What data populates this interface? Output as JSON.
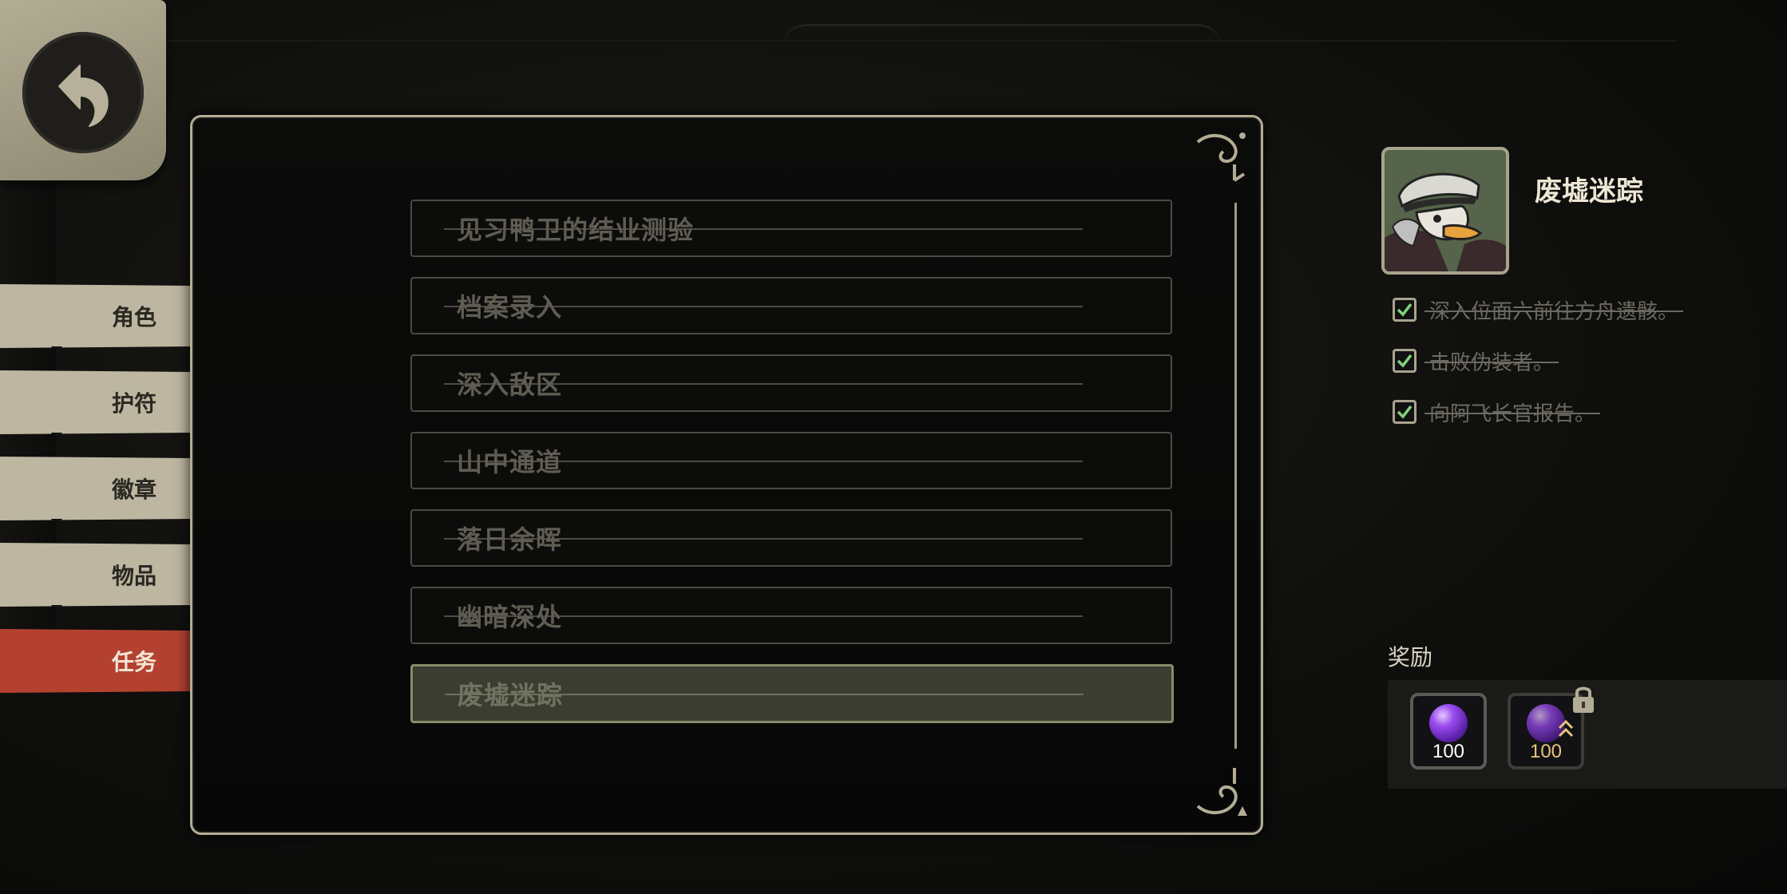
{
  "navigation": {
    "back_icon": "back-arrow-icon"
  },
  "tabs": [
    {
      "label": "角色",
      "active": false
    },
    {
      "label": "护符",
      "active": false
    },
    {
      "label": "徽章",
      "active": false
    },
    {
      "label": "物品",
      "active": false
    },
    {
      "label": "任务",
      "active": true
    }
  ],
  "quests": [
    {
      "label": "见习鸭卫的结业测验",
      "completed": true,
      "selected": false
    },
    {
      "label": "档案录入",
      "completed": true,
      "selected": false
    },
    {
      "label": "深入敌区",
      "completed": true,
      "selected": false
    },
    {
      "label": "山中通道",
      "completed": true,
      "selected": false
    },
    {
      "label": "落日余晖",
      "completed": true,
      "selected": false
    },
    {
      "label": "幽暗深处",
      "completed": true,
      "selected": false
    },
    {
      "label": "废墟迷踪",
      "completed": true,
      "selected": true
    }
  ],
  "detail": {
    "title": "废墟迷踪",
    "portrait": "duck-officer-portrait",
    "objectives": [
      {
        "text": "深入位面六前往方舟遗骸。",
        "done": true
      },
      {
        "text": "击败伪装者。",
        "done": true
      },
      {
        "text": "向阿飞长官报告。",
        "done": true
      }
    ],
    "rewards_title": "奖励",
    "rewards": [
      {
        "icon": "purple-orb-icon",
        "count": "100",
        "locked": false,
        "color": "#ffffff"
      },
      {
        "icon": "purple-orb-upgrade-icon",
        "count": "100",
        "locked": true,
        "color": "#e8c37a"
      }
    ]
  },
  "colors": {
    "tab_default": "#bdb7a1",
    "tab_active": "#b4412f",
    "frame": "#b3ad95",
    "check": "#7fd17a"
  }
}
